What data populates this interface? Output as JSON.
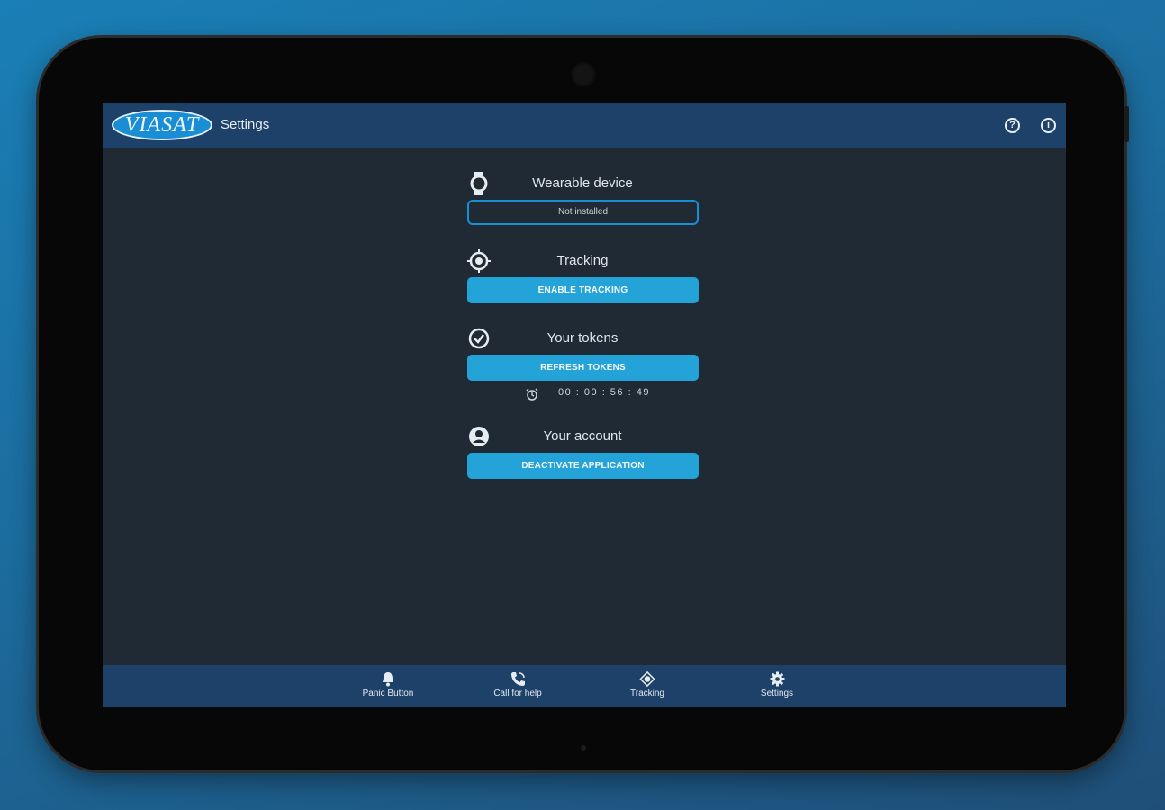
{
  "header": {
    "logo_text": "VIASAT",
    "title": "Settings",
    "icons": [
      "help-icon",
      "info-icon"
    ]
  },
  "sections": {
    "wearable": {
      "title": "Wearable device",
      "icon": "watch-icon",
      "status": "Not installed"
    },
    "tracking": {
      "title": "Tracking",
      "icon": "target-icon",
      "button": "ENABLE TRACKING"
    },
    "tokens": {
      "title": "Your tokens",
      "icon": "check-circle-icon",
      "button": "REFRESH TOKENS",
      "timer": "00 : 00 : 56 : 49"
    },
    "account": {
      "title": "Your account",
      "icon": "account-icon",
      "button": "DEACTIVATE APPLICATION"
    }
  },
  "bottom_nav": [
    {
      "label": "Panic Button",
      "icon": "bell-icon"
    },
    {
      "label": "Call for help",
      "icon": "phone-icon"
    },
    {
      "label": "Tracking",
      "icon": "target-icon"
    },
    {
      "label": "Settings",
      "icon": "gear-icon"
    }
  ],
  "colors": {
    "background": "#1f2a34",
    "bar": "#1d4168",
    "accent": "#23a3d8",
    "outline": "#1a8ed4"
  }
}
